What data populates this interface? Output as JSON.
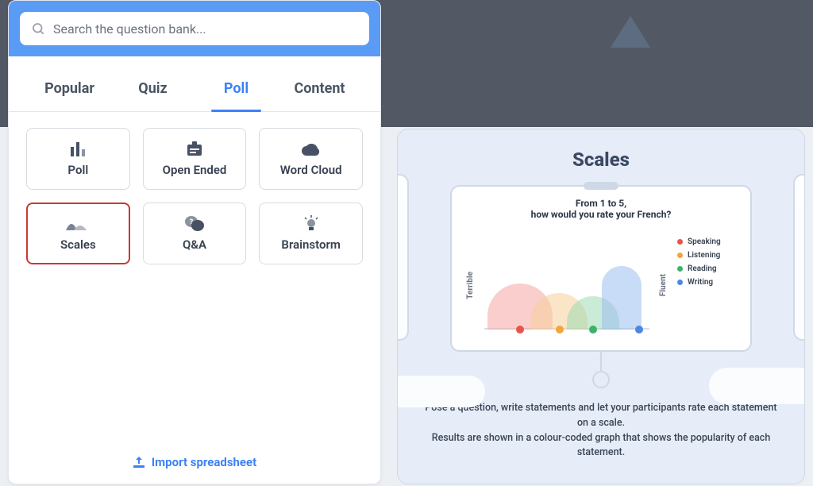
{
  "search": {
    "placeholder": "Search the question bank..."
  },
  "tabs": [
    {
      "label": "Popular",
      "active": false
    },
    {
      "label": "Quiz",
      "active": false
    },
    {
      "label": "Poll",
      "active": true
    },
    {
      "label": "Content",
      "active": false
    }
  ],
  "cards": [
    {
      "label": "Poll",
      "icon": "poll",
      "selected": false
    },
    {
      "label": "Open Ended",
      "icon": "open-ended",
      "selected": false
    },
    {
      "label": "Word Cloud",
      "icon": "cloud",
      "selected": false
    },
    {
      "label": "Scales",
      "icon": "scales",
      "selected": true
    },
    {
      "label": "Q&A",
      "icon": "qa",
      "selected": false
    },
    {
      "label": "Brainstorm",
      "icon": "brainstorm",
      "selected": false
    }
  ],
  "import_label": "Import spreadsheet",
  "preview": {
    "title": "Scales",
    "question_line1": "From 1 to 5,",
    "question_line2": "how would you rate your French?",
    "axis_low": "Terrible",
    "axis_high": "Fluent",
    "legend": [
      {
        "label": "Speaking",
        "color": "#e8544e"
      },
      {
        "label": "Listening",
        "color": "#f2a63b"
      },
      {
        "label": "Reading",
        "color": "#3fb26a"
      },
      {
        "label": "Writing",
        "color": "#4f86e3"
      }
    ],
    "description_line1": "Pose a question, write statements and let your participants rate each statement on a scale.",
    "description_line2": "Results are shown in a colour-coded graph that shows the popularity of each statement."
  },
  "chart_data": {
    "type": "area",
    "title": "From 1 to 5, how would you rate your French?",
    "xlabel_low": "Terrible",
    "xlabel_high": "Fluent",
    "x_range": [
      1,
      5
    ],
    "series": [
      {
        "name": "Speaking",
        "color": "#e8544e",
        "peak_x": 1.8,
        "peak_height": 0.7,
        "spread": 1.3
      },
      {
        "name": "Listening",
        "color": "#f2a63b",
        "peak_x": 2.6,
        "peak_height": 0.55,
        "spread": 1.1
      },
      {
        "name": "Reading",
        "color": "#3fb26a",
        "peak_x": 3.4,
        "peak_height": 0.5,
        "spread": 1.0
      },
      {
        "name": "Writing",
        "color": "#4f86e3",
        "peak_x": 4.3,
        "peak_height": 0.95,
        "spread": 0.8
      }
    ]
  }
}
